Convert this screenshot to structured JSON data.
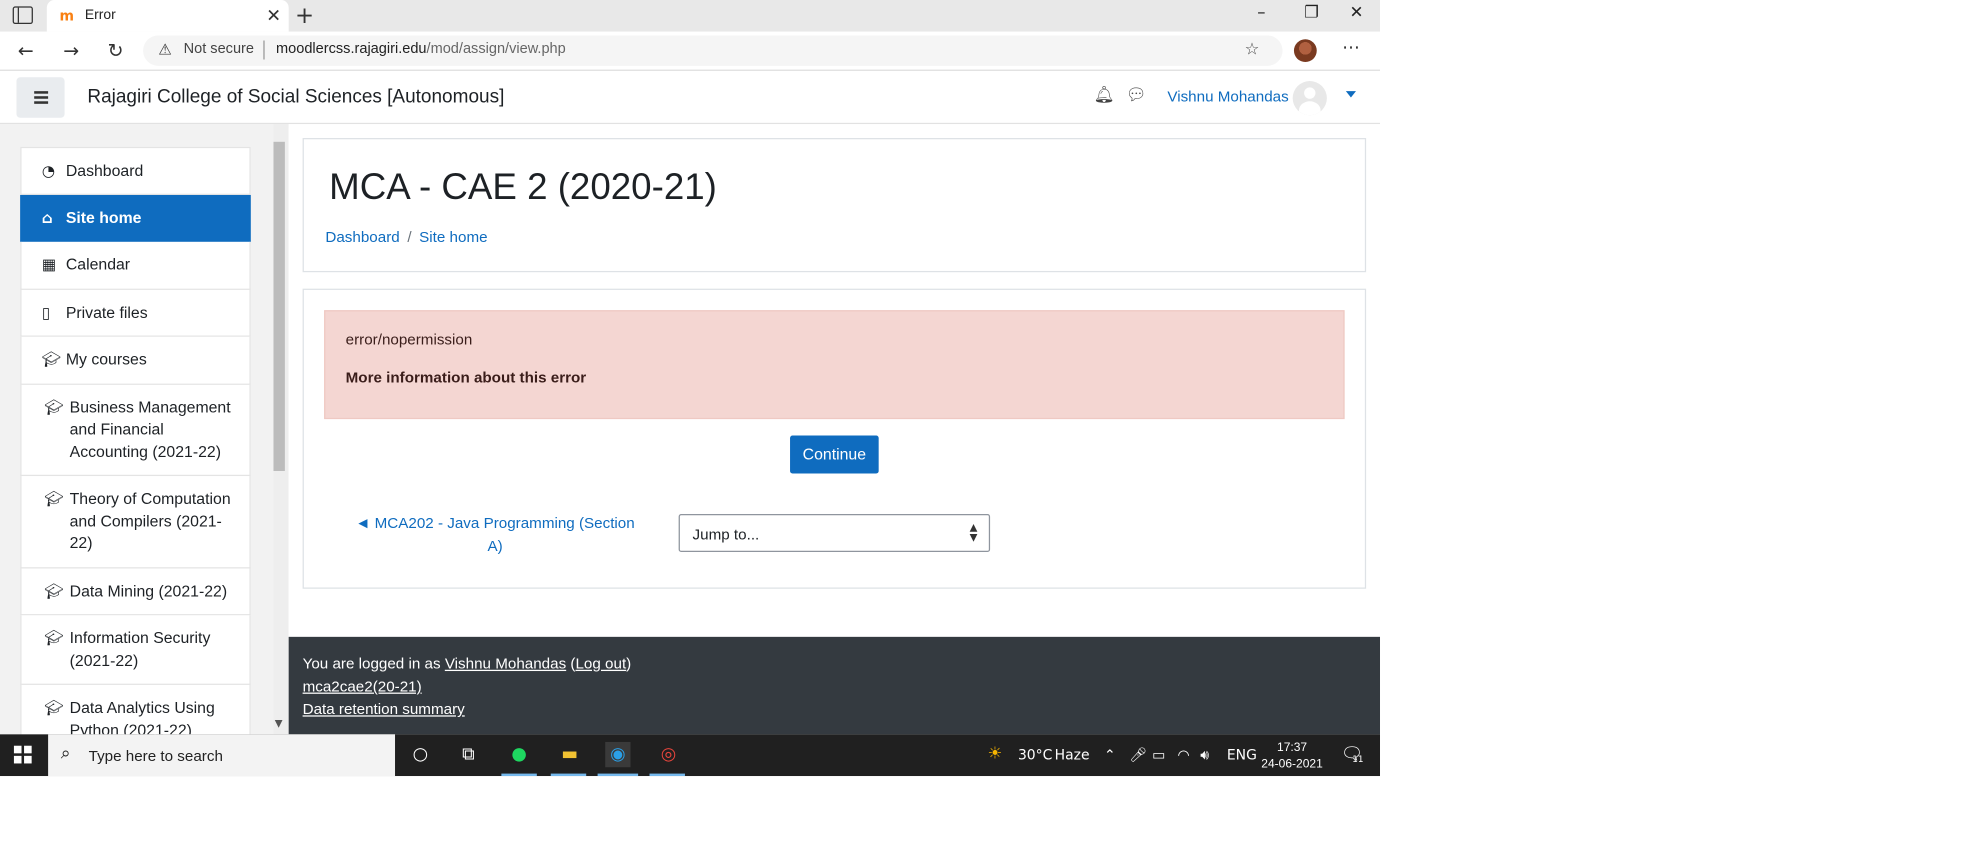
{
  "browser": {
    "tab_title": "Error",
    "tab_favicon": "m",
    "not_secure": "Not secure",
    "url_domain": "moodlercss.rajagiri.edu",
    "url_path": "/mod/assign/view.php"
  },
  "navbar": {
    "site_name": "Rajagiri College of Social Sciences [Autonomous]",
    "user_name": "Vishnu Mohandas"
  },
  "sidebar": {
    "items": [
      {
        "label": "Dashboard",
        "icon": "dashboard-icon"
      },
      {
        "label": "Site home",
        "icon": "home-icon",
        "active": true
      },
      {
        "label": "Calendar",
        "icon": "calendar-icon"
      },
      {
        "label": "Private files",
        "icon": "file-icon"
      },
      {
        "label": "My courses",
        "icon": "graduation-cap-icon"
      }
    ],
    "courses": [
      "Business Management and Financial Accounting (2021-22)",
      "Theory of Computation and Compilers (2021-22)",
      "Data Mining (2021-22)",
      "Information Security (2021-22)",
      "Data Analytics Using Python (2021-22)"
    ]
  },
  "main": {
    "page_title": "MCA - CAE 2 (2020-21)",
    "breadcrumb": [
      "Dashboard",
      "Site home"
    ],
    "error_code": "error/nopermission",
    "error_more": "More information about this error",
    "continue_label": "Continue",
    "prev_link": "◄ MCA202 - Java Programming (Section A)",
    "jump_placeholder": "Jump to..."
  },
  "footer": {
    "logged_in_prefix": "You are logged in as",
    "user_link": "Vishnu Mohandas",
    "logout_link": "Log out",
    "course_link": "mca2cae2(20-21)",
    "retention_link": "Data retention summary"
  },
  "taskbar": {
    "search_placeholder": "Type here to search",
    "weather_temp": "30°C",
    "weather_text": "Haze",
    "language": "ENG",
    "time": "17:37",
    "date": "24-06-2021",
    "notification_count": "11"
  },
  "colors": {
    "accent": "#0f6cbf",
    "alert_bg": "#f4d6d2",
    "footer_bg": "#343a40",
    "taskbar_bg": "#202020"
  }
}
